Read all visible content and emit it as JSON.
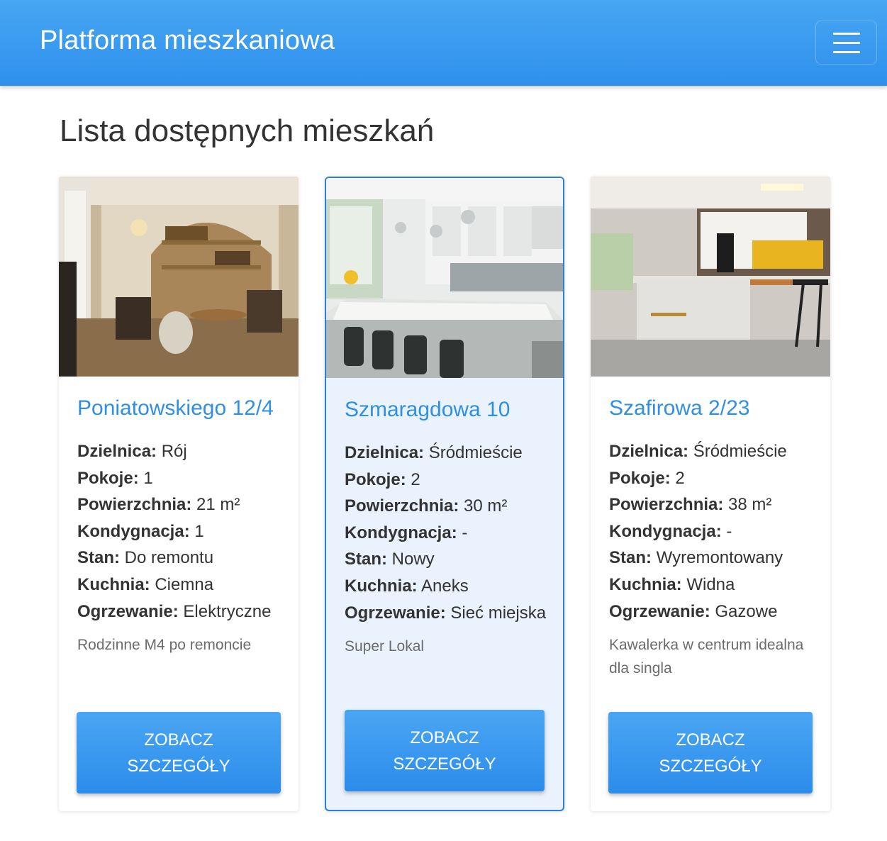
{
  "navbar": {
    "brand": "Platforma mieszkaniowa",
    "menu_icon": "hamburger-menu-icon"
  },
  "page": {
    "heading": "Lista dostępnych mieszkań"
  },
  "labels": {
    "district": "Dzielnica:",
    "rooms": "Pokoje:",
    "area": "Powierzchnia:",
    "floor": "Kondygnacja:",
    "condition": "Stan:",
    "kitchen": "Kuchnia:",
    "heating": "Ogrzewanie:",
    "details_button": "ZOBACZ SZCZEGÓŁY"
  },
  "cards": [
    {
      "title": "Poniatowskiego 12/4",
      "district": "Rój",
      "rooms": "1",
      "area": "21 m²",
      "floor": "1",
      "condition": "Do remontu",
      "kitchen": "Ciemna",
      "heating": "Elektryczne",
      "description": "Rodzinne M4 po remoncie",
      "photo": "living-room-photo"
    },
    {
      "title": "Szmaragdowa 10",
      "district": "Śródmieście",
      "rooms": "2",
      "area": "30 m²",
      "floor": "-",
      "condition": "Nowy",
      "kitchen": "Aneks",
      "heating": "Sieć miejska",
      "description": "Super Lokal",
      "photo": "white-kitchen-photo",
      "selected": true
    },
    {
      "title": "Szafirowa 2/23",
      "district": "Śródmieście",
      "rooms": "2",
      "area": "38 m²",
      "floor": "-",
      "condition": "Wyremontowany",
      "kitchen": "Widna",
      "heating": "Gazowe",
      "description": "Kawalerka w centrum idealna dla singla",
      "photo": "modern-kitchen-photo"
    }
  ]
}
